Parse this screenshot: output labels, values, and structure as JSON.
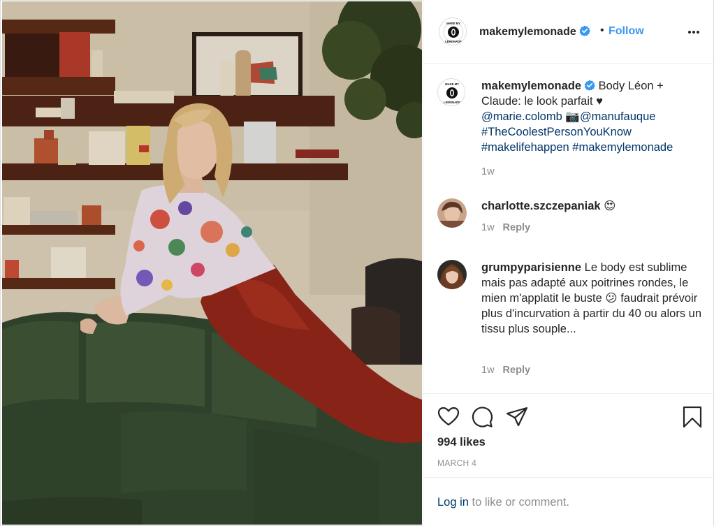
{
  "colors": {
    "accent_blue": "#3897f0",
    "hashtag_blue": "#003569",
    "text_dark": "#262626",
    "text_muted": "#8e8e8e",
    "border": "#efefef"
  },
  "photo": {
    "logo_text": "MAKE MY LEMONADE"
  },
  "header": {
    "username": "makemylemonade",
    "verified": true,
    "separator": "•",
    "follow_label": "Follow",
    "more_icon": "more-horizontal-icon"
  },
  "caption": {
    "username": "makemylemonade",
    "text": "Body Léon + Claude: le look parfait ♥",
    "mention1": "@marie.colomb",
    "camera": "📷",
    "mention2": "@manufauque",
    "hashtag1": "#TheCoolestPersonYouKnow",
    "hashtag2": "#makelifehappen",
    "hashtag3": "#makemylemonade",
    "time": "1w"
  },
  "comments": [
    {
      "username": "charlotte.szczepaniak",
      "text": "😍",
      "time": "1w",
      "reply_label": "Reply"
    },
    {
      "username": "grumpyparisienne",
      "text": "Le body est sublime mais pas adapté aux poitrines rondes, le mien m'applatit le buste 😕 faudrait prévoir plus d'incurvation à partir du 40 ou alors un tissu plus souple...",
      "time": "1w",
      "reply_label": "Reply"
    }
  ],
  "actions": {
    "like_icon": "heart-icon",
    "comment_icon": "comment-icon",
    "share_icon": "paper-plane-icon",
    "save_icon": "bookmark-icon",
    "likes": "994 likes",
    "date": "MARCH 4"
  },
  "login": {
    "link_label": "Log in",
    "suffix": " to like or comment."
  }
}
